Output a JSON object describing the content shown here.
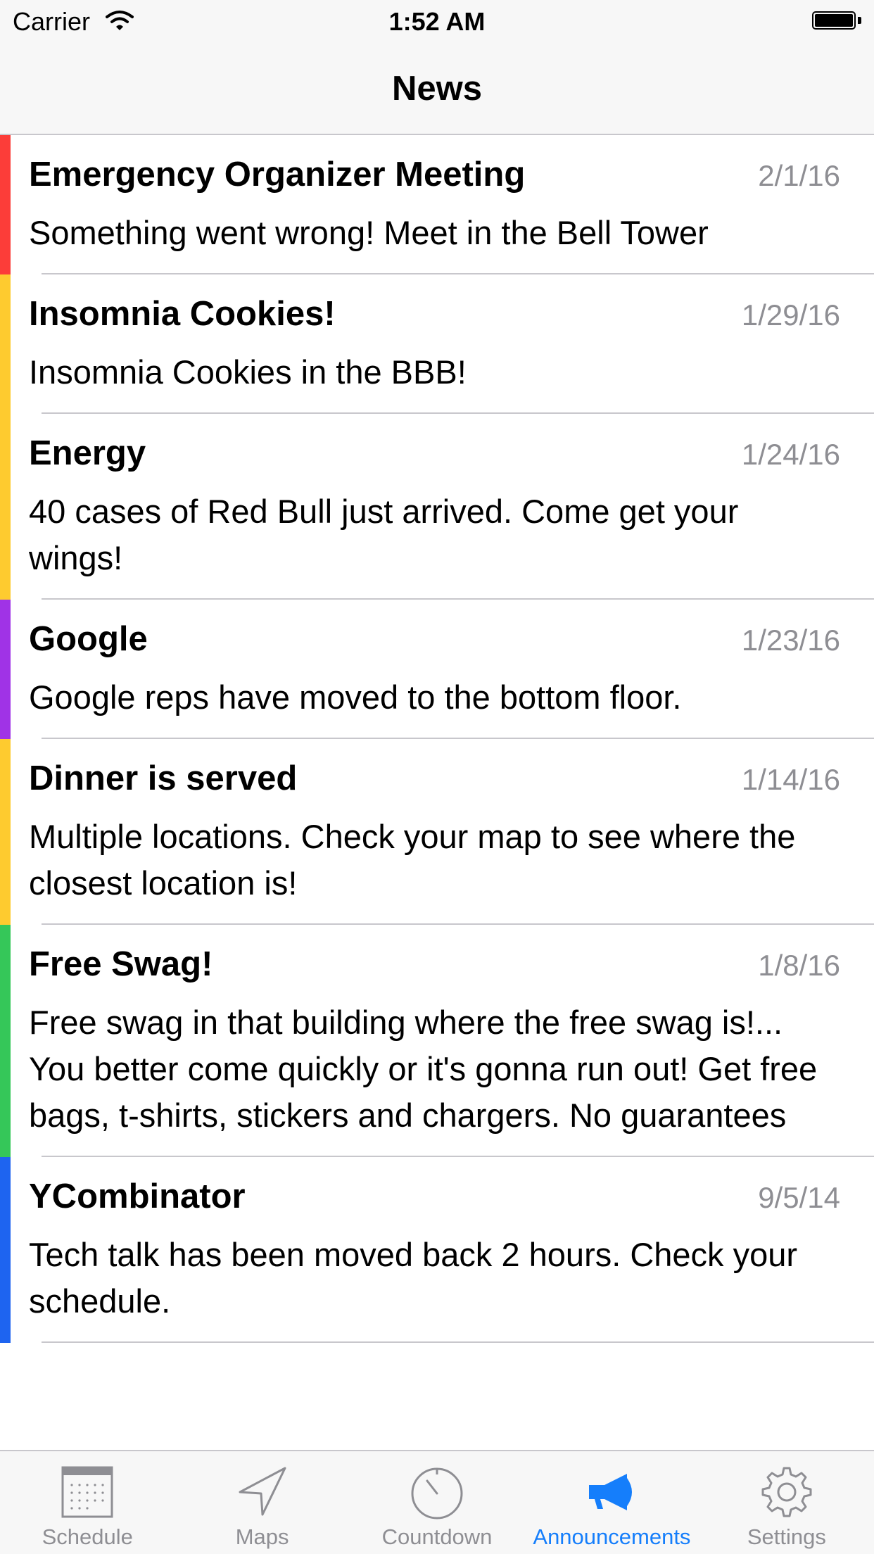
{
  "status_bar": {
    "carrier": "Carrier",
    "time": "1:52 AM"
  },
  "nav": {
    "title": "News"
  },
  "announcements": [
    {
      "title": "Emergency Organizer Meeting",
      "date": "2/1/16",
      "body": "Something went wrong! Meet in the Bell Tower",
      "color": "#fc3d39"
    },
    {
      "title": "Insomnia Cookies!",
      "date": "1/29/16",
      "body": "Insomnia Cookies in the BBB!",
      "color": "#fecb2f"
    },
    {
      "title": "Energy",
      "date": "1/24/16",
      "body": "40 cases of Red Bull just arrived. Come get your wings!",
      "color": "#fecb2f"
    },
    {
      "title": "Google",
      "date": "1/23/16",
      "body": "Google reps have moved to the bottom floor.",
      "color": "#a033e6"
    },
    {
      "title": "Dinner is served",
      "date": "1/14/16",
      "body": "Multiple locations. Check your map to see where the closest location is!",
      "color": "#fecb2f"
    },
    {
      "title": "Free Swag!",
      "date": "1/8/16",
      "body": "Free swag in that building where the free swag is!... You better come quickly or it's gonna run out! Get free bags, t-shirts, stickers and chargers. No guarantees",
      "color": "#35c759"
    },
    {
      "title": "YCombinator",
      "date": "9/5/14",
      "body": "Tech talk has been moved back 2 hours. Check your schedule.",
      "color": "#1e64f0"
    }
  ],
  "tabs": [
    {
      "label": "Schedule",
      "icon": "calendar-icon"
    },
    {
      "label": "Maps",
      "icon": "location-arrow-icon"
    },
    {
      "label": "Countdown",
      "icon": "stopwatch-icon"
    },
    {
      "label": "Announcements",
      "icon": "megaphone-icon",
      "active": true
    },
    {
      "label": "Settings",
      "icon": "gear-icon"
    }
  ],
  "colors": {
    "tint": "#157efb",
    "inactive": "#8e8e93",
    "separator": "#c8c7cc"
  }
}
